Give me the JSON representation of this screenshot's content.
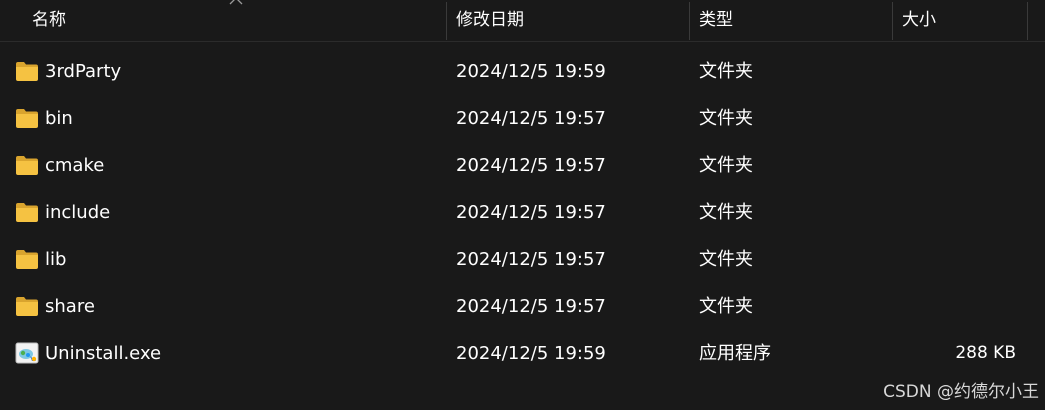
{
  "columns": {
    "name": "名称",
    "modified": "修改日期",
    "type": "类型",
    "size": "大小"
  },
  "files": [
    {
      "name": "3rdParty",
      "modified": "2024/12/5 19:59",
      "type": "文件夹",
      "size": "",
      "icon": "folder-icon"
    },
    {
      "name": "bin",
      "modified": "2024/12/5 19:57",
      "type": "文件夹",
      "size": "",
      "icon": "folder-icon"
    },
    {
      "name": "cmake",
      "modified": "2024/12/5 19:57",
      "type": "文件夹",
      "size": "",
      "icon": "folder-icon"
    },
    {
      "name": "include",
      "modified": "2024/12/5 19:57",
      "type": "文件夹",
      "size": "",
      "icon": "folder-icon"
    },
    {
      "name": "lib",
      "modified": "2024/12/5 19:57",
      "type": "文件夹",
      "size": "",
      "icon": "folder-icon"
    },
    {
      "name": "share",
      "modified": "2024/12/5 19:57",
      "type": "文件夹",
      "size": "",
      "icon": "folder-icon"
    },
    {
      "name": "Uninstall.exe",
      "modified": "2024/12/5 19:59",
      "type": "应用程序",
      "size": "288 KB",
      "icon": "installer-icon"
    }
  ],
  "watermark": "CSDN @约德尔小王",
  "colors": {
    "background": "#191919",
    "folder": "#f5c242",
    "text": "#ffffff"
  }
}
